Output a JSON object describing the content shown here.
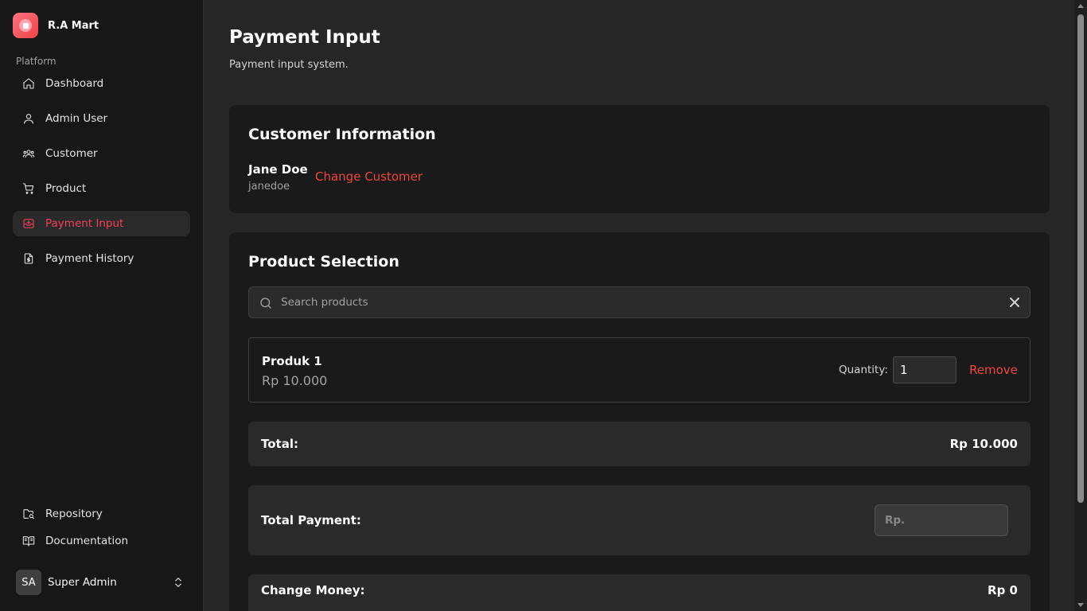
{
  "app": {
    "name": "R.A Mart"
  },
  "sidebar": {
    "section_label": "Platform",
    "items": [
      {
        "label": "Dashboard",
        "icon": "home-icon",
        "active": false
      },
      {
        "label": "Admin User",
        "icon": "user-icon",
        "active": false
      },
      {
        "label": "Customer",
        "icon": "users-icon",
        "active": false
      },
      {
        "label": "Product",
        "icon": "cart-icon",
        "active": false
      },
      {
        "label": "Payment Input",
        "icon": "inbox-icon",
        "active": true
      },
      {
        "label": "Payment History",
        "icon": "file-dollar-icon",
        "active": false
      }
    ],
    "footer_items": [
      {
        "label": "Repository",
        "icon": "folder-search-icon"
      },
      {
        "label": "Documentation",
        "icon": "book-icon"
      }
    ],
    "user": {
      "initials": "SA",
      "name": "Super Admin",
      "icon": "chevrons-up-down-icon"
    }
  },
  "page": {
    "title": "Payment Input",
    "subtitle": "Payment input system."
  },
  "customer_card": {
    "title": "Customer Information",
    "name": "Jane Doe",
    "username": "janedoe",
    "change_label": "Change Customer"
  },
  "product_card": {
    "title": "Product Selection",
    "search": {
      "placeholder": "Search products",
      "value": ""
    },
    "items": [
      {
        "name": "Produk 1",
        "price": "Rp 10.000",
        "quantity_label": "Quantity:",
        "quantity": "1",
        "remove_label": "Remove"
      }
    ],
    "total_label": "Total:",
    "total_value": "Rp 10.000",
    "payment_label": "Total Payment:",
    "payment_placeholder": "Rp.",
    "change_label": "Change Money:",
    "change_value": "Rp 0"
  },
  "colors": {
    "accent": "#ef4444",
    "background": "#262626",
    "sidebar": "#171717",
    "card": "#1a1a1a"
  }
}
